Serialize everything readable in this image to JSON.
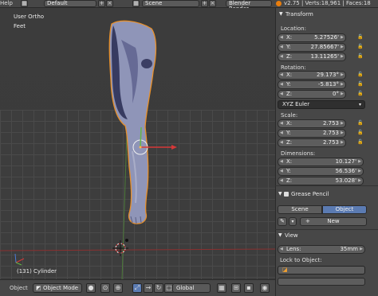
{
  "topbar": {
    "menu_help": "Help",
    "layout_name": "Default",
    "scene_name": "Scene",
    "render_engine": "Blender Render",
    "stats": "v2.75 | Verts:18,961 | Faces:18"
  },
  "viewport": {
    "view_name": "User Ortho",
    "units": "Feet",
    "object_info": "(131) Cylinder"
  },
  "bottombar": {
    "menu_object": "Object",
    "mode": "Object Mode",
    "orientation": "Global"
  },
  "panel": {
    "transform_title": "Transform",
    "location_label": "Location:",
    "location": [
      {
        "axis": "X:",
        "value": "5.27526'"
      },
      {
        "axis": "Y:",
        "value": "27.85667'"
      },
      {
        "axis": "Z:",
        "value": "13.11265'"
      }
    ],
    "rotation_label": "Rotation:",
    "rotation": [
      {
        "axis": "X:",
        "value": "29.173°"
      },
      {
        "axis": "Y:",
        "value": "-5.813°"
      },
      {
        "axis": "Z:",
        "value": "0°"
      }
    ],
    "rotation_mode": "XYZ Euler",
    "scale_label": "Scale:",
    "scale": [
      {
        "axis": "X:",
        "value": "2.753"
      },
      {
        "axis": "Y:",
        "value": "2.753"
      },
      {
        "axis": "Z:",
        "value": "2.753"
      }
    ],
    "dimensions_label": "Dimensions:",
    "dimensions": [
      {
        "axis": "X:",
        "value": "10.127'"
      },
      {
        "axis": "Y:",
        "value": "56.536'"
      },
      {
        "axis": "Z:",
        "value": "53.028'"
      }
    ],
    "grease_pencil_title": "Grease Pencil",
    "gp_scene": "Scene",
    "gp_object": "Object",
    "gp_new": "New",
    "view_title": "View",
    "lens_label": "Lens:",
    "lens_value": "35mm",
    "lock_label": "Lock to Object:"
  },
  "colors": {
    "accent": "#5b7bb2",
    "selection_outline": "#e8902a",
    "x_axis": "#c83c3c",
    "y_axis": "#6aa84f"
  }
}
